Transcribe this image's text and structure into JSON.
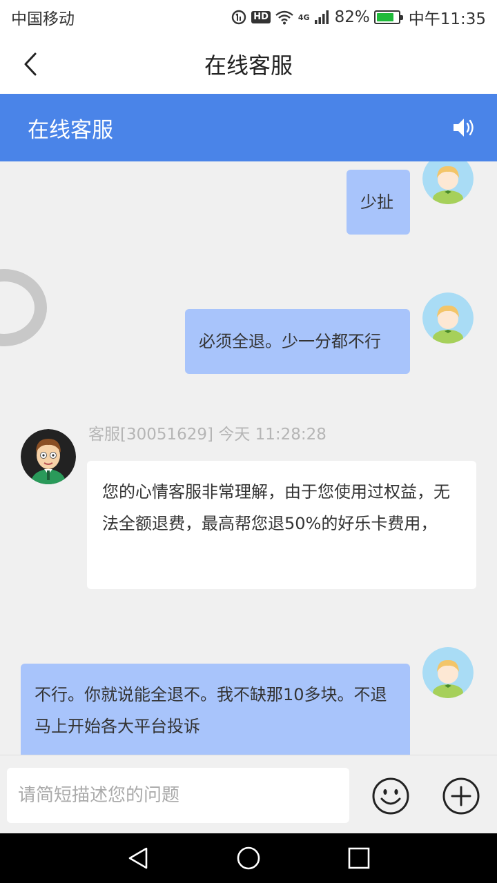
{
  "status_bar": {
    "carrier": "中国移动",
    "hd": "HD",
    "network": "4G",
    "battery_percent": "82%",
    "battery_level": 0.82,
    "time": "中午11:35"
  },
  "nav": {
    "title": "在线客服"
  },
  "chat_header": {
    "title": "在线客服"
  },
  "messages": [
    {
      "sender": "me",
      "text": "少扯"
    },
    {
      "sender": "me",
      "text": "必须全退。少一分都不行"
    },
    {
      "sender": "agent",
      "meta": "客服[30051629]  今天 11:28:28",
      "text": "您的心情客服非常理解，由于您使用过权益，无法全额退费，最高帮您退50%的好乐卡费用，"
    },
    {
      "sender": "me",
      "text": "不行。你就说能全退不。我不缺那10多块。不退马上开始各大平台投诉"
    }
  ],
  "input": {
    "placeholder": "请简短描述您的问题",
    "value": ""
  },
  "colors": {
    "header_blue": "#4a84e8",
    "my_bubble": "#a8c4fb",
    "agent_bubble": "#ffffff"
  }
}
